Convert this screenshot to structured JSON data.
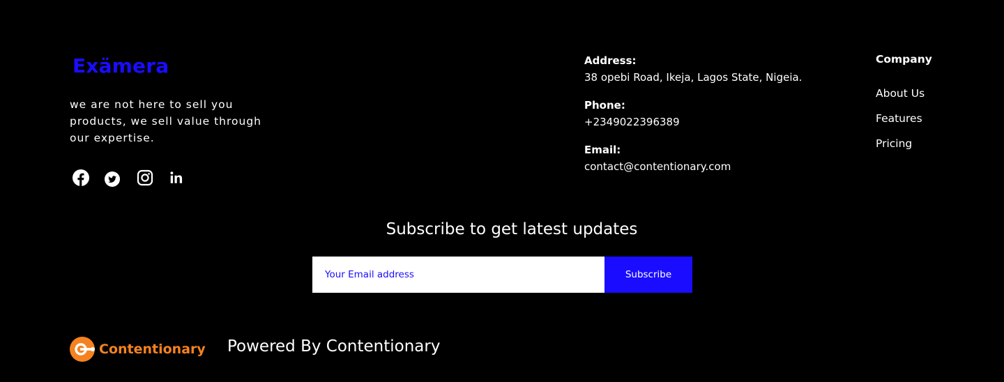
{
  "brand": {
    "name": "Exämera",
    "color": "#1a0dff"
  },
  "tagline": "we are not here to sell you products, we sell value through our expertise.",
  "socials": [
    {
      "name": "facebook",
      "icon": "facebook-icon"
    },
    {
      "name": "twitter",
      "icon": "twitter-icon"
    },
    {
      "name": "instagram",
      "icon": "instagram-icon"
    },
    {
      "name": "linkedin",
      "icon": "linkedin-icon"
    }
  ],
  "contact": {
    "address_label": "Address:",
    "address_value": "38 opebi Road, Ikeja, Lagos State, Nigeia.",
    "phone_label": "Phone:",
    "phone_value": "+2349022396389",
    "email_label": "Email:",
    "email_value": "contact@contentionary.com"
  },
  "company": {
    "heading": "Company",
    "links": [
      "About Us",
      "Features",
      "Pricing"
    ]
  },
  "subscribe": {
    "title": "Subscribe to get latest updates",
    "placeholder": "Your Email address",
    "button_label": "Subscribe",
    "accent": "#1a0dff"
  },
  "footer": {
    "logo_text": "Contentionary",
    "logo_color": "#f58220",
    "powered_text": "Powered By Contentionary"
  }
}
